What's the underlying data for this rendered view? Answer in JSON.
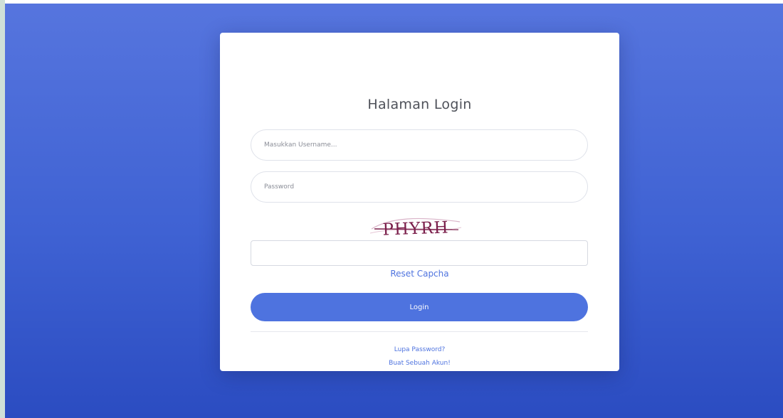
{
  "form": {
    "title": "Halaman Login",
    "username_placeholder": "Masukkan Username...",
    "password_placeholder": "Password",
    "captcha_text": "PHYRH",
    "captcha_input_value": "",
    "reset_captcha_label": "Reset Capcha",
    "login_button_label": "Login",
    "forgot_password_label": "Lupa Password?",
    "register_label": "Buat Sebuah Akun!"
  },
  "colors": {
    "primary": "#4e73df",
    "background_top": "#5675de",
    "background_bottom": "#2b4cc1",
    "captcha_ink": "#7a1e4a"
  }
}
